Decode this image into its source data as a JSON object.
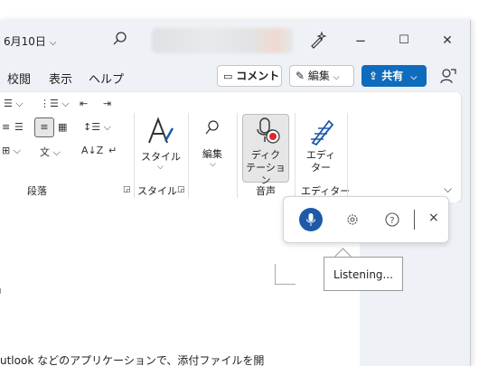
{
  "titlebar": {
    "date_label": "6月10日",
    "minimize": "−",
    "maximize": "☐",
    "close": "✕"
  },
  "menu": {
    "items": [
      "校閲",
      "表示",
      "ヘルプ"
    ]
  },
  "actions": {
    "comment_label": "コメント",
    "edit_label": "編集",
    "share_label": "共有"
  },
  "ribbon": {
    "paragraph_group": "段落",
    "style_label": "スタイル",
    "style_group": "スタイル",
    "edit_label": "編集",
    "dictate_label_1": "ディク",
    "dictate_label_2": "テーション",
    "voice_group": "音声",
    "editor_label_1": "エディ",
    "editor_label_2": "ター",
    "editor_group": "エディター"
  },
  "document": {
    "visible_text": "utlook などのアプリケーションで、添付ファイルを開"
  },
  "dictation": {
    "close": "×",
    "tooltip": "Listening..."
  },
  "colors": {
    "accent": "#0f6cbd",
    "mic": "#1e5aa8",
    "record": "#e0252e"
  }
}
